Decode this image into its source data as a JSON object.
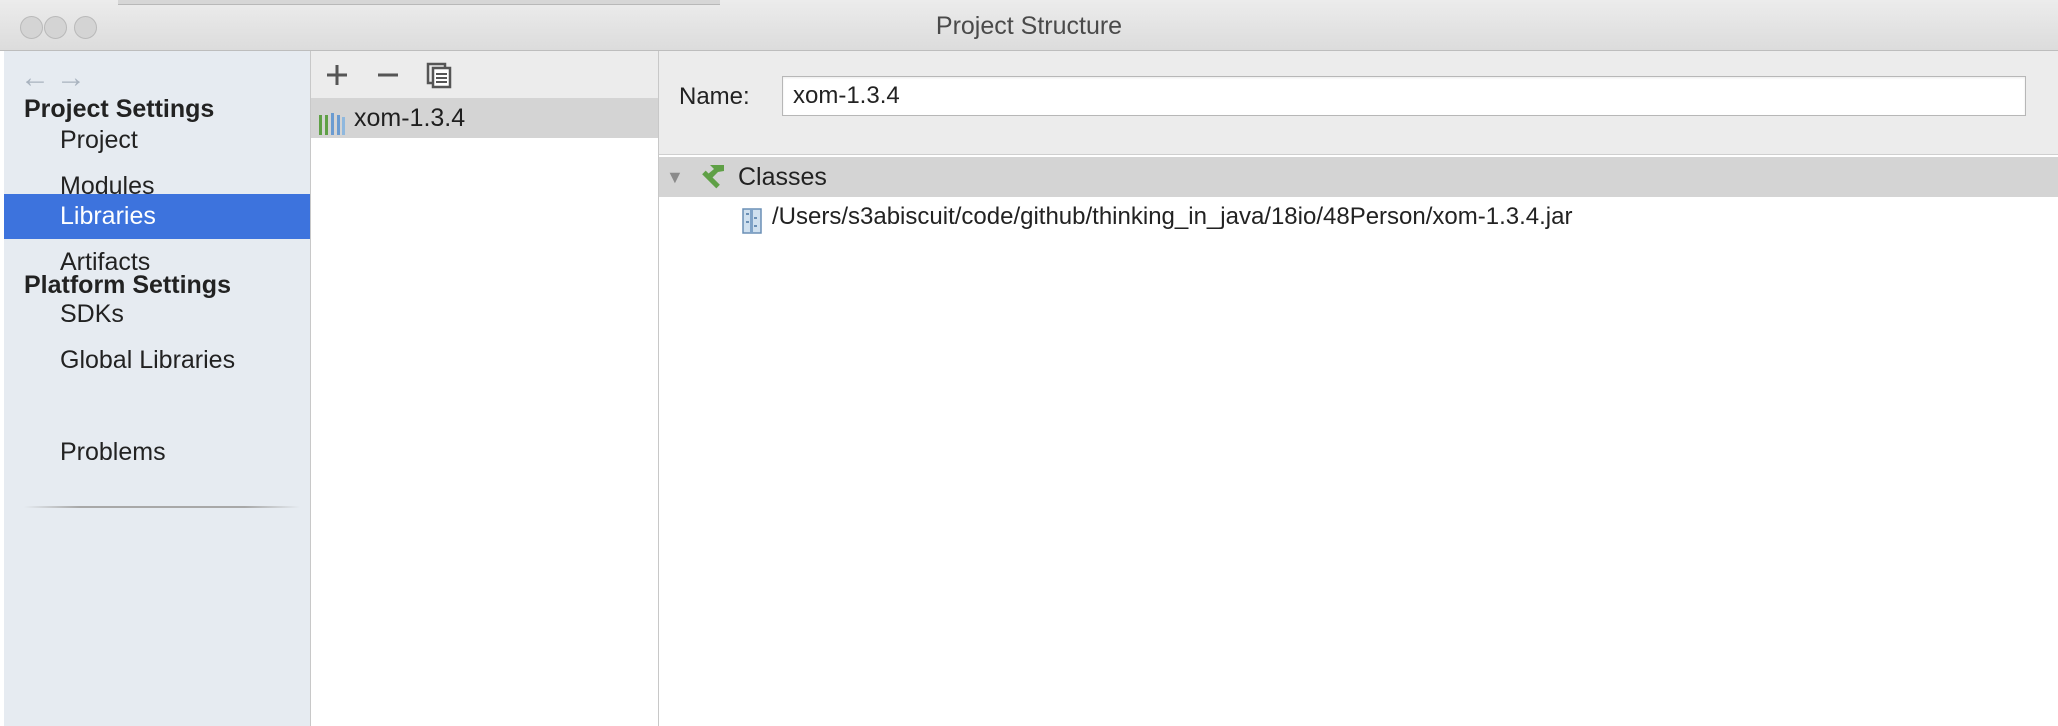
{
  "window": {
    "title": "Project Structure"
  },
  "navigation": {
    "back_icon": "←",
    "forward_icon": "→"
  },
  "sidebar": {
    "project_settings_header": "Project Settings",
    "platform_settings_header": "Platform Settings",
    "items": {
      "project": "Project",
      "modules": "Modules",
      "libraries": "Libraries",
      "artifacts": "Artifacts",
      "sdks": "SDKs",
      "global_libraries": "Global Libraries",
      "problems": "Problems"
    },
    "selected": "libraries"
  },
  "library_list": {
    "toolbar_icons": [
      "plus-icon",
      "minus-icon",
      "copy-icon"
    ],
    "items": [
      {
        "label": "xom-1.3.4",
        "icon": "library-icon",
        "selected": true
      }
    ]
  },
  "details": {
    "name_label": "Name:",
    "name_value": "xom-1.3.4",
    "tree": {
      "root_label": "Classes",
      "root_expanded": true,
      "children": [
        {
          "path": "/Users/s3abiscuit/code/github/thinking_in_java/18io/48Person/xom-1.3.4.jar",
          "icon": "jar-icon"
        }
      ]
    }
  },
  "colors": {
    "accent": "#3d73dd",
    "sidebar_bg": "#e6ebf1",
    "selected_row_bg": "#d4d4d4",
    "tool_green": "#5fa046"
  }
}
